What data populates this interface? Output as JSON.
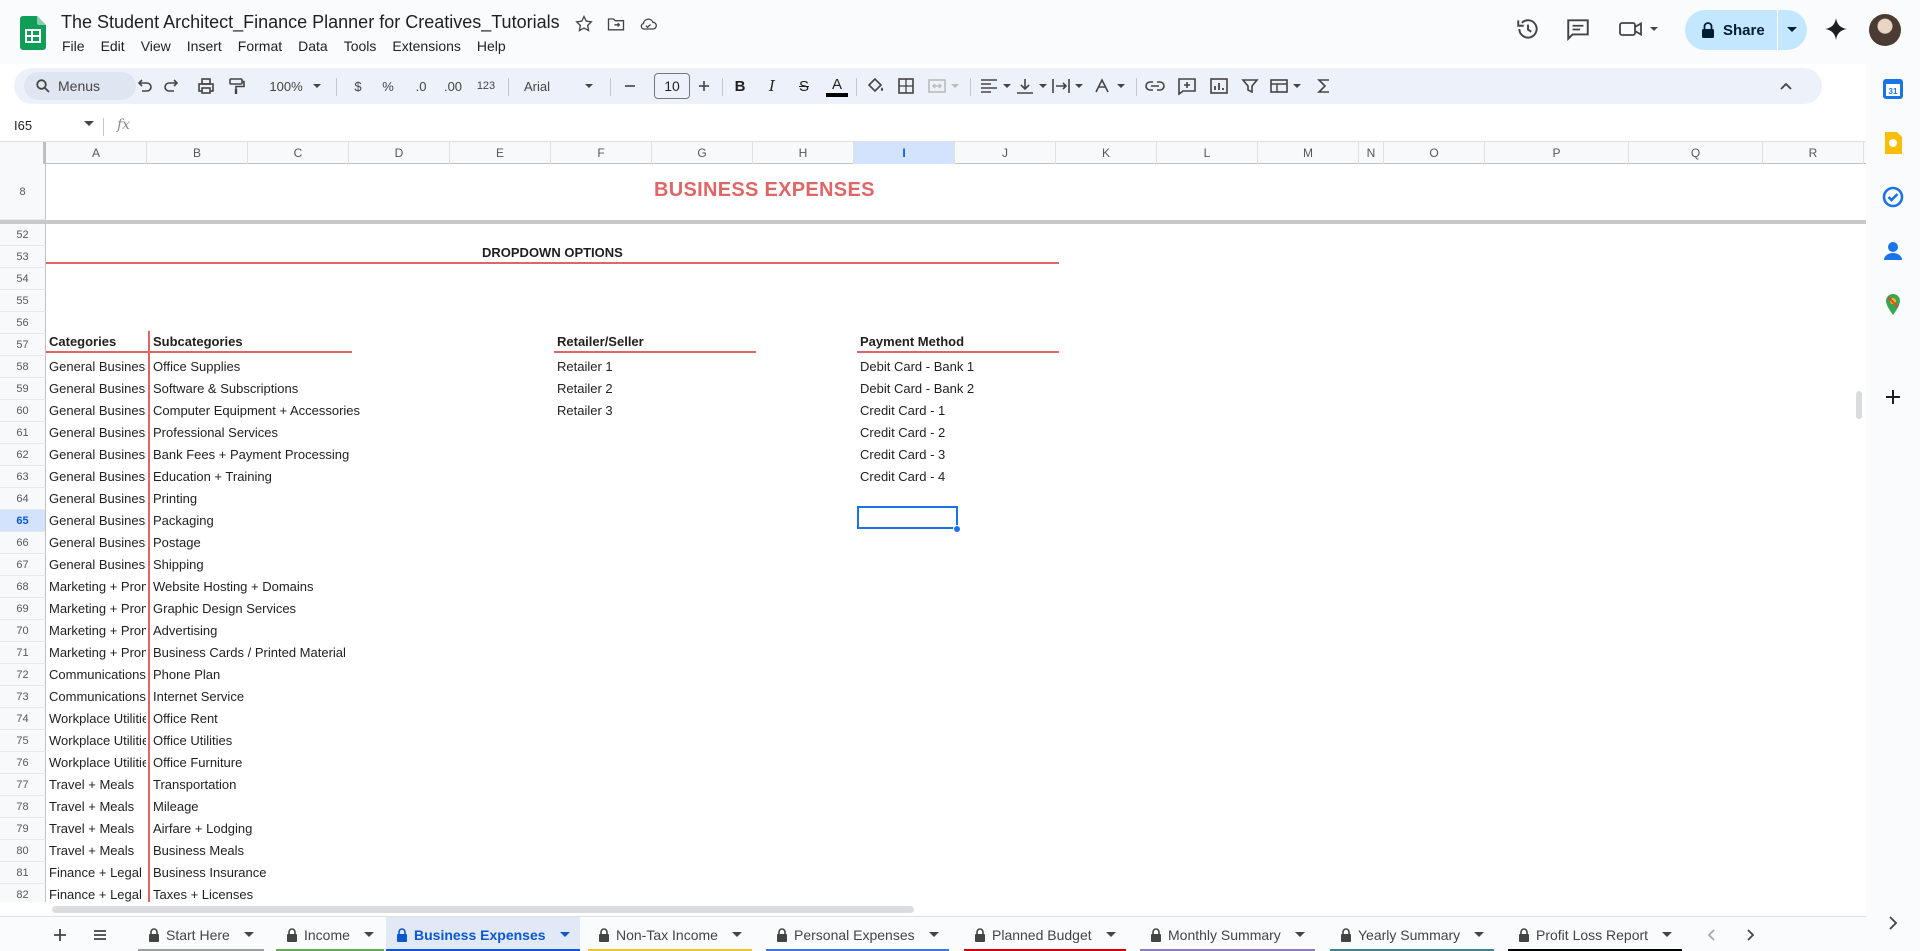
{
  "document": {
    "title": "The Student Architect_Finance Planner for Creatives_Tutorials",
    "star_icon": "star-icon",
    "move_icon": "folder-move-icon",
    "cloud_icon": "cloud-saved-icon"
  },
  "menus": [
    "File",
    "Edit",
    "View",
    "Insert",
    "Format",
    "Data",
    "Tools",
    "Extensions",
    "Help"
  ],
  "header_actions": {
    "history_icon": "history-icon",
    "comments_icon": "comment-icon",
    "meet_icon": "video-call-icon",
    "share_label": "Share",
    "gemini_icon": "sparkle-icon"
  },
  "toolbar": {
    "search_label": "Menus",
    "zoom": "100%",
    "currency": "$",
    "percent": "%",
    "decrease_decimal": ".0",
    "increase_decimal": ".00",
    "more_formats": "123",
    "font": "Arial",
    "font_size": "10",
    "bold": "B",
    "italic": "I",
    "strike": "S",
    "text_color": "A"
  },
  "formula_bar": {
    "cell_ref": "I65",
    "fx": "fx",
    "value": ""
  },
  "columns": [
    {
      "id": "A",
      "selected": false
    },
    {
      "id": "B",
      "selected": false
    },
    {
      "id": "C",
      "selected": false
    },
    {
      "id": "D",
      "selected": false
    },
    {
      "id": "E",
      "selected": false
    },
    {
      "id": "F",
      "selected": false
    },
    {
      "id": "G",
      "selected": false
    },
    {
      "id": "H",
      "selected": false
    },
    {
      "id": "I",
      "selected": true
    },
    {
      "id": "J",
      "selected": false
    },
    {
      "id": "K",
      "selected": false
    },
    {
      "id": "L",
      "selected": false
    },
    {
      "id": "M",
      "selected": false
    },
    {
      "id": "N",
      "selected": false
    },
    {
      "id": "O",
      "selected": false
    },
    {
      "id": "P",
      "selected": false
    },
    {
      "id": "Q",
      "selected": false
    },
    {
      "id": "R",
      "selected": false
    }
  ],
  "frozen_row": {
    "number": "8",
    "title": "BUSINESS EXPENSES"
  },
  "section_title": "DROPDOWN OPTIONS",
  "headers": {
    "categories": "Categories",
    "subcategories": "Subcategories",
    "retailer": "Retailer/Seller",
    "payment": "Payment Method"
  },
  "rows": [
    {
      "n": "52",
      "a": "",
      "b": "",
      "f": "",
      "j": ""
    },
    {
      "n": "53",
      "a": "",
      "b": "",
      "f": "",
      "j": ""
    },
    {
      "n": "54",
      "a": "",
      "b": "",
      "f": "",
      "j": ""
    },
    {
      "n": "55",
      "a": "",
      "b": "",
      "f": "",
      "j": ""
    },
    {
      "n": "56",
      "a": "",
      "b": "",
      "f": "",
      "j": ""
    },
    {
      "n": "57",
      "a": "",
      "b": "",
      "f": "",
      "j": ""
    },
    {
      "n": "58",
      "a": "General Business",
      "b": "Office Supplies",
      "f": "Retailer 1",
      "j": "Debit Card - Bank 1"
    },
    {
      "n": "59",
      "a": "General Business",
      "b": "Software & Subscriptions",
      "f": "Retailer 2",
      "j": "Debit Card - Bank 2"
    },
    {
      "n": "60",
      "a": "General Business",
      "b": "Computer Equipment + Accessories",
      "f": "Retailer 3",
      "j": "Credit Card - 1"
    },
    {
      "n": "61",
      "a": "General Business",
      "b": "Professional Services",
      "f": "",
      "j": "Credit Card - 2"
    },
    {
      "n": "62",
      "a": "General Business",
      "b": "Bank Fees + Payment Processing",
      "f": "",
      "j": "Credit Card - 3"
    },
    {
      "n": "63",
      "a": "General Business",
      "b": "Education + Training",
      "f": "",
      "j": "Credit Card - 4"
    },
    {
      "n": "64",
      "a": "General Business",
      "b": "Printing",
      "f": "",
      "j": ""
    },
    {
      "n": "65",
      "a": "General Business",
      "b": "Packaging",
      "f": "",
      "j": ""
    },
    {
      "n": "66",
      "a": "General Business",
      "b": "Postage",
      "f": "",
      "j": ""
    },
    {
      "n": "67",
      "a": "General Business",
      "b": "Shipping",
      "f": "",
      "j": ""
    },
    {
      "n": "68",
      "a": "Marketing + Promotion",
      "b": "Website Hosting + Domains",
      "f": "",
      "j": ""
    },
    {
      "n": "69",
      "a": "Marketing + Promotion",
      "b": "Graphic Design Services",
      "f": "",
      "j": ""
    },
    {
      "n": "70",
      "a": "Marketing + Promotion",
      "b": "Advertising",
      "f": "",
      "j": ""
    },
    {
      "n": "71",
      "a": "Marketing + Promotion",
      "b": "Business Cards / Printed Material",
      "f": "",
      "j": ""
    },
    {
      "n": "72",
      "a": "Communications",
      "b": "Phone Plan",
      "f": "",
      "j": ""
    },
    {
      "n": "73",
      "a": "Communications",
      "b": "Internet Service",
      "f": "",
      "j": ""
    },
    {
      "n": "74",
      "a": "Workplace Utilities",
      "b": "Office Rent",
      "f": "",
      "j": ""
    },
    {
      "n": "75",
      "a": "Workplace Utilities",
      "b": "Office Utilities",
      "f": "",
      "j": ""
    },
    {
      "n": "76",
      "a": "Workplace Utilities",
      "b": "Office Furniture",
      "f": "",
      "j": ""
    },
    {
      "n": "77",
      "a": "Travel + Meals",
      "b": "Transportation",
      "f": "",
      "j": ""
    },
    {
      "n": "78",
      "a": "Travel + Meals",
      "b": "Mileage",
      "f": "",
      "j": ""
    },
    {
      "n": "79",
      "a": "Travel + Meals",
      "b": "Airfare + Lodging",
      "f": "",
      "j": ""
    },
    {
      "n": "80",
      "a": "Travel + Meals",
      "b": "Business Meals",
      "f": "",
      "j": ""
    },
    {
      "n": "81",
      "a": "Finance + Legal",
      "b": "Business Insurance",
      "f": "",
      "j": ""
    },
    {
      "n": "82",
      "a": "Finance + Legal",
      "b": "Taxes + Licenses",
      "f": "",
      "j": ""
    }
  ],
  "selected_row": "65",
  "sheet_tabs": [
    {
      "label": "Start Here",
      "active": false,
      "color": "#9e9e9e"
    },
    {
      "label": "Income",
      "active": false,
      "color": "#6aa84f"
    },
    {
      "label": "Business Expenses",
      "active": true,
      "color": "#0b57d0"
    },
    {
      "label": "Non-Tax Income",
      "active": false,
      "color": "#f1c232"
    },
    {
      "label": "Personal Expenses",
      "active": false,
      "color": "#3c78d8"
    },
    {
      "label": "Planned Budget",
      "active": false,
      "color": "#cc0000"
    },
    {
      "label": "Monthly Summary",
      "active": false,
      "color": "#8e7cc3"
    },
    {
      "label": "Yearly Summary",
      "active": false,
      "color": "#45818e"
    },
    {
      "label": "Profit Loss Report",
      "active": false,
      "color": "#000000"
    }
  ],
  "side_panel": [
    "calendar-icon",
    "keep-icon",
    "tasks-icon",
    "contacts-icon",
    "maps-icon",
    "add-icon"
  ],
  "colors": {
    "accent_red": "#e06666",
    "selection_blue": "#1a73e8",
    "share_bg": "#c2e7ff",
    "sheets_green": "#0f9d58"
  }
}
